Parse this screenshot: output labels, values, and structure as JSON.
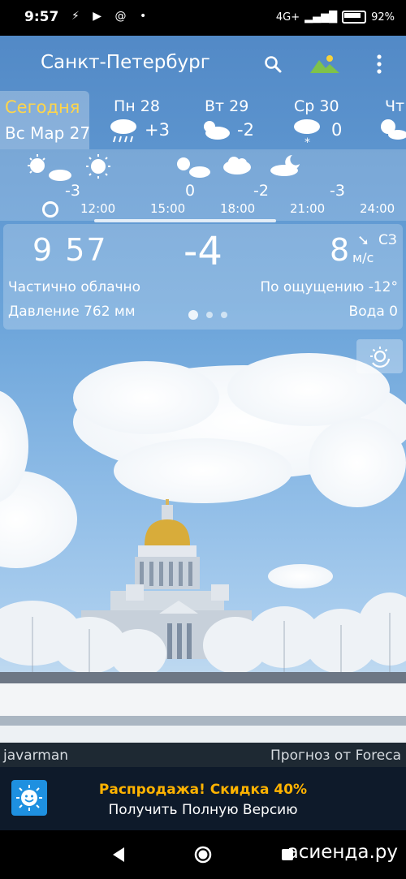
{
  "status_bar": {
    "time": "9:57",
    "battery": "92%",
    "network": "4G+"
  },
  "toolbar": {
    "city": "Санкт-Петербург"
  },
  "days": [
    {
      "name": "Сегодня",
      "date": "Вс Мар 27",
      "icon": "partly-cloudy-icon"
    },
    {
      "name": "Пн 28",
      "temp": "+3",
      "icon": "rain-icon"
    },
    {
      "name": "Вт 29",
      "temp": "-2",
      "icon": "partly-cloudy-icon"
    },
    {
      "name": "Ср 30",
      "temp": "0",
      "icon": "snow-icon"
    },
    {
      "name": "Чт",
      "icon": "partly-cloudy-icon"
    }
  ],
  "hourly": {
    "temps": [
      "-3",
      "0",
      "-2",
      "-3"
    ],
    "times": [
      "12:00",
      "15:00",
      "18:00",
      "21:00",
      "24:00"
    ]
  },
  "current": {
    "time": "9 57",
    "temp": "-4",
    "wind_speed": "8",
    "wind_dir": "СЗ",
    "wind_unit": "м/с",
    "condition": "Частично облачно",
    "feels_like": "По ощущению -12°",
    "pressure": "Давление 762 мм",
    "water": "Вода 0",
    "page_count": 3,
    "active_page": 1
  },
  "attribution": {
    "photo_author": "javarman",
    "provider": "Прогноз от Foreca"
  },
  "promo": {
    "line1": "Распродажа! Скидка 40%",
    "line2": "Получить Полную Версию"
  },
  "watermark": "асиенда.ру",
  "colors": {
    "today_highlight": "#ffd54a",
    "promo_accent": "#ffb300",
    "promo_bg": "#0e1a2a"
  }
}
